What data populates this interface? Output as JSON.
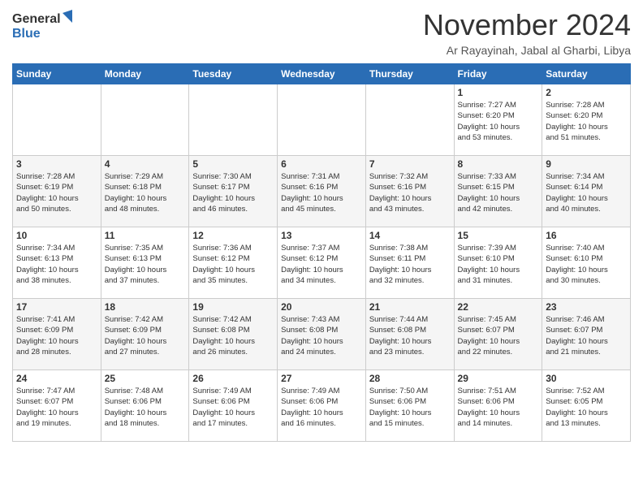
{
  "header": {
    "logo_general": "General",
    "logo_blue": "Blue",
    "month_title": "November 2024",
    "location": "Ar Rayayinah, Jabal al Gharbi, Libya"
  },
  "weekdays": [
    "Sunday",
    "Monday",
    "Tuesday",
    "Wednesday",
    "Thursday",
    "Friday",
    "Saturday"
  ],
  "weeks": [
    [
      {
        "day": "",
        "info": ""
      },
      {
        "day": "",
        "info": ""
      },
      {
        "day": "",
        "info": ""
      },
      {
        "day": "",
        "info": ""
      },
      {
        "day": "",
        "info": ""
      },
      {
        "day": "1",
        "info": "Sunrise: 7:27 AM\nSunset: 6:20 PM\nDaylight: 10 hours\nand 53 minutes."
      },
      {
        "day": "2",
        "info": "Sunrise: 7:28 AM\nSunset: 6:20 PM\nDaylight: 10 hours\nand 51 minutes."
      }
    ],
    [
      {
        "day": "3",
        "info": "Sunrise: 7:28 AM\nSunset: 6:19 PM\nDaylight: 10 hours\nand 50 minutes."
      },
      {
        "day": "4",
        "info": "Sunrise: 7:29 AM\nSunset: 6:18 PM\nDaylight: 10 hours\nand 48 minutes."
      },
      {
        "day": "5",
        "info": "Sunrise: 7:30 AM\nSunset: 6:17 PM\nDaylight: 10 hours\nand 46 minutes."
      },
      {
        "day": "6",
        "info": "Sunrise: 7:31 AM\nSunset: 6:16 PM\nDaylight: 10 hours\nand 45 minutes."
      },
      {
        "day": "7",
        "info": "Sunrise: 7:32 AM\nSunset: 6:16 PM\nDaylight: 10 hours\nand 43 minutes."
      },
      {
        "day": "8",
        "info": "Sunrise: 7:33 AM\nSunset: 6:15 PM\nDaylight: 10 hours\nand 42 minutes."
      },
      {
        "day": "9",
        "info": "Sunrise: 7:34 AM\nSunset: 6:14 PM\nDaylight: 10 hours\nand 40 minutes."
      }
    ],
    [
      {
        "day": "10",
        "info": "Sunrise: 7:34 AM\nSunset: 6:13 PM\nDaylight: 10 hours\nand 38 minutes."
      },
      {
        "day": "11",
        "info": "Sunrise: 7:35 AM\nSunset: 6:13 PM\nDaylight: 10 hours\nand 37 minutes."
      },
      {
        "day": "12",
        "info": "Sunrise: 7:36 AM\nSunset: 6:12 PM\nDaylight: 10 hours\nand 35 minutes."
      },
      {
        "day": "13",
        "info": "Sunrise: 7:37 AM\nSunset: 6:12 PM\nDaylight: 10 hours\nand 34 minutes."
      },
      {
        "day": "14",
        "info": "Sunrise: 7:38 AM\nSunset: 6:11 PM\nDaylight: 10 hours\nand 32 minutes."
      },
      {
        "day": "15",
        "info": "Sunrise: 7:39 AM\nSunset: 6:10 PM\nDaylight: 10 hours\nand 31 minutes."
      },
      {
        "day": "16",
        "info": "Sunrise: 7:40 AM\nSunset: 6:10 PM\nDaylight: 10 hours\nand 30 minutes."
      }
    ],
    [
      {
        "day": "17",
        "info": "Sunrise: 7:41 AM\nSunset: 6:09 PM\nDaylight: 10 hours\nand 28 minutes."
      },
      {
        "day": "18",
        "info": "Sunrise: 7:42 AM\nSunset: 6:09 PM\nDaylight: 10 hours\nand 27 minutes."
      },
      {
        "day": "19",
        "info": "Sunrise: 7:42 AM\nSunset: 6:08 PM\nDaylight: 10 hours\nand 26 minutes."
      },
      {
        "day": "20",
        "info": "Sunrise: 7:43 AM\nSunset: 6:08 PM\nDaylight: 10 hours\nand 24 minutes."
      },
      {
        "day": "21",
        "info": "Sunrise: 7:44 AM\nSunset: 6:08 PM\nDaylight: 10 hours\nand 23 minutes."
      },
      {
        "day": "22",
        "info": "Sunrise: 7:45 AM\nSunset: 6:07 PM\nDaylight: 10 hours\nand 22 minutes."
      },
      {
        "day": "23",
        "info": "Sunrise: 7:46 AM\nSunset: 6:07 PM\nDaylight: 10 hours\nand 21 minutes."
      }
    ],
    [
      {
        "day": "24",
        "info": "Sunrise: 7:47 AM\nSunset: 6:07 PM\nDaylight: 10 hours\nand 19 minutes."
      },
      {
        "day": "25",
        "info": "Sunrise: 7:48 AM\nSunset: 6:06 PM\nDaylight: 10 hours\nand 18 minutes."
      },
      {
        "day": "26",
        "info": "Sunrise: 7:49 AM\nSunset: 6:06 PM\nDaylight: 10 hours\nand 17 minutes."
      },
      {
        "day": "27",
        "info": "Sunrise: 7:49 AM\nSunset: 6:06 PM\nDaylight: 10 hours\nand 16 minutes."
      },
      {
        "day": "28",
        "info": "Sunrise: 7:50 AM\nSunset: 6:06 PM\nDaylight: 10 hours\nand 15 minutes."
      },
      {
        "day": "29",
        "info": "Sunrise: 7:51 AM\nSunset: 6:06 PM\nDaylight: 10 hours\nand 14 minutes."
      },
      {
        "day": "30",
        "info": "Sunrise: 7:52 AM\nSunset: 6:05 PM\nDaylight: 10 hours\nand 13 minutes."
      }
    ]
  ]
}
